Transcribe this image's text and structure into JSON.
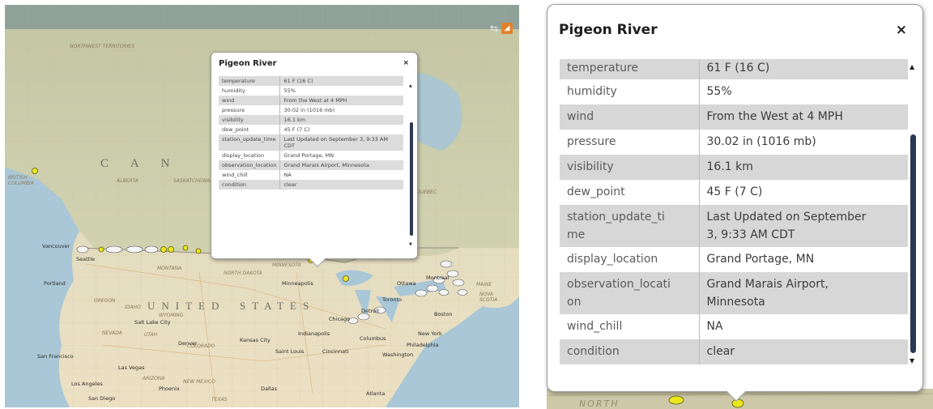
{
  "map": {
    "country_labels": [
      "C A N",
      "UNITED",
      "STATES"
    ],
    "region_labels": [
      "NORTHWEST TERRITORIES",
      "BRITISH COLUMBIA",
      "ALBERTA",
      "SASKATCHEWAN",
      "MONTANA",
      "NORTH DAKOTA",
      "WYOMING",
      "OREGON",
      "IDAHO",
      "NEVADA",
      "UTAH",
      "COLORADO",
      "ARIZONA",
      "NEW MEXICO",
      "TEXAS",
      "QUEBEC",
      "NOVA SCOTIA",
      "MAINE",
      "MINNESOTA"
    ],
    "city_labels": [
      "Vancouver",
      "Seattle",
      "Portland",
      "San Francisco",
      "Los Angeles",
      "San Diego",
      "Salt Lake City",
      "Denver",
      "Las Vegas",
      "Phoenix",
      "Kansas City",
      "Saint Louis",
      "Dallas",
      "Minneapolis",
      "Chicago",
      "Detroit",
      "Indianapolis",
      "Cincinnati",
      "Columbus",
      "Atlanta",
      "Washington",
      "Philadelphia",
      "New York",
      "Boston",
      "Ottawa",
      "Montreal",
      "Toronto"
    ],
    "toolbar": {
      "share_icon": "share-icon",
      "rss_icon": "rss-icon"
    }
  },
  "popup": {
    "title": "Pigeon River",
    "close_symbol": "×",
    "rows": [
      {
        "key": "temperature",
        "value": "61 F (16 C)"
      },
      {
        "key": "humidity",
        "value": "55%"
      },
      {
        "key": "wind",
        "value": "From the West at 4 MPH"
      },
      {
        "key": "pressure",
        "value": "30.02 in (1016 mb)"
      },
      {
        "key": "visibility",
        "value": "16.1 km"
      },
      {
        "key": "dew_point",
        "value": "45 F (7 C)"
      },
      {
        "key": "station_update_time",
        "value": "Last Updated on September 3, 9:33 AM CDT"
      },
      {
        "key": "display_location",
        "value": "Grand Portage, MN"
      },
      {
        "key": "observation_location",
        "value": "Grand Marais Airport, Minnesota"
      },
      {
        "key": "wind_chill",
        "value": "NA"
      },
      {
        "key": "condition",
        "value": "clear"
      }
    ],
    "zoom_rows": [
      {
        "key": "temperature",
        "value": "61 F (16 C)"
      },
      {
        "key": "humidity",
        "value": "55%"
      },
      {
        "key": "wind",
        "value": "From the West at 4 MPH"
      },
      {
        "key": "pressure",
        "value": "30.02 in (1016 mb)"
      },
      {
        "key": "visibility",
        "value": "16.1 km"
      },
      {
        "key": "dew_point",
        "value": "45 F (7 C)"
      },
      {
        "key": "station_update_ti\nme",
        "value": "Last Updated on September\n3, 9:33 AM CDT"
      },
      {
        "key": "display_location",
        "value": "Grand Portage, MN"
      },
      {
        "key": "observation_locati\non",
        "value": "Grand Marais Airport,\nMinnesota"
      },
      {
        "key": "wind_chill",
        "value": "NA"
      },
      {
        "key": "condition",
        "value": "clear"
      }
    ],
    "zoom_map_label": "NORTH"
  }
}
